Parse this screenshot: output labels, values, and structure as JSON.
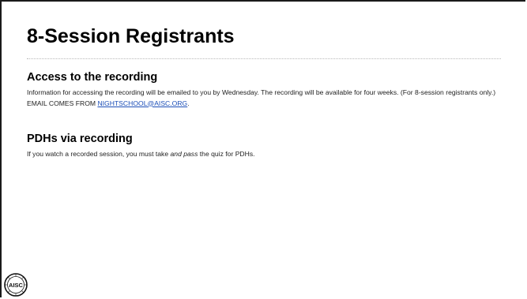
{
  "slide": {
    "title": "8-Session Registrants",
    "sections": [
      {
        "heading": "Access to the recording",
        "body_1": "Information for accessing the recording will be emailed to you by Wednesday.  The recording will be available for four weeks.  (For 8-session registrants only.)   EMAIL COMES FROM ",
        "link": "NIGHTSCHOOL@AISC.ORG",
        "body_2": "."
      },
      {
        "heading": "PDHs via recording",
        "body_1": "If you watch a recorded session, you must take ",
        "emphasis": "and pass",
        "body_2": " the quiz for PDHs."
      }
    ],
    "logo_text": "AISC",
    "colors": {
      "link": "#1d4fb8",
      "text": "#000000",
      "border": "#1a1a1a"
    }
  }
}
